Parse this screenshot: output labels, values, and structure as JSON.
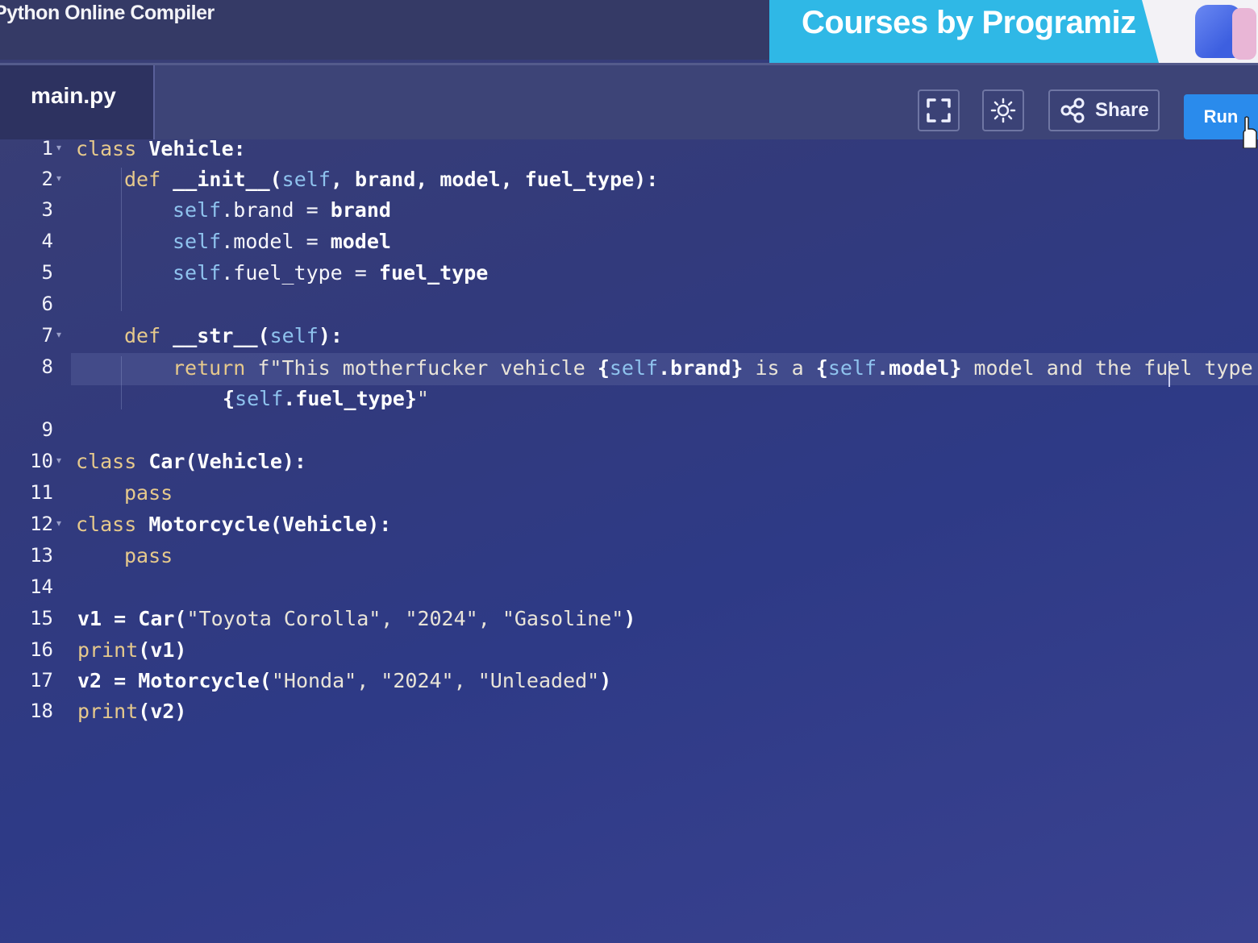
{
  "app": {
    "title": "Python Online Compiler"
  },
  "banner": {
    "text": "Courses by Programiz"
  },
  "editor": {
    "file_name": "main.py",
    "toolbar": {
      "fullscreen_icon": "fullscreen-icon",
      "theme_icon": "sun-icon",
      "share_icon": "share-icon",
      "share_label": "Share",
      "run_label": "Run"
    },
    "line_numbers": [
      "1",
      "2",
      "3",
      "4",
      "5",
      "6",
      "7",
      "8",
      "9",
      "10",
      "11",
      "12",
      "13",
      "14",
      "15",
      "16",
      "17",
      "18"
    ],
    "code": {
      "l1": {
        "kw": "class",
        "rest": " Vehicle:"
      },
      "l2": {
        "kw": "def",
        "name": " __init__(",
        "self": "self",
        "rest": ", brand, model, fuel_type):"
      },
      "l3": {
        "self": "self",
        "attr": ".brand = ",
        "rest": "brand"
      },
      "l4": {
        "self": "self",
        "attr": ".model = ",
        "rest": "model"
      },
      "l5": {
        "self": "self",
        "attr": ".fuel_type = ",
        "rest": "fuel_type"
      },
      "l7": {
        "kw": "def",
        "name": " __str__(",
        "self": "self",
        "rest": "):"
      },
      "l8a": {
        "kw": "return",
        "str1": " f\"This motherfucker vehicle ",
        "e1a": "{",
        "e1s": "self",
        "e1b": ".brand}",
        "str2": " is a ",
        "e2a": "{",
        "e2s": "self",
        "e2b": ".model}",
        "str3": " model and the fuel type is"
      },
      "l8b": {
        "e3a": "{",
        "e3s": "self",
        "e3b": ".fuel_type}",
        "str4": "\""
      },
      "l10": {
        "kw": "class",
        "rest": " Car(Vehicle):"
      },
      "l11": {
        "kw": "pass"
      },
      "l12": {
        "kw": "class",
        "rest": " Motorcycle(Vehicle):"
      },
      "l13": {
        "kw": "pass"
      },
      "l15": {
        "a": "v1 = ",
        "b": "Car(",
        "s": "\"Toyota Corolla\", \"2024\", \"Gasoline\"",
        "c": ")"
      },
      "l16": {
        "fn": "print",
        "rest": "(v1)"
      },
      "l17": {
        "a": "v2 = ",
        "b": "Motorcycle(",
        "s": "\"Honda\", \"2024\", \"Unleaded\"",
        "c": ")"
      },
      "l18": {
        "fn": "print",
        "rest": "(v2)"
      }
    },
    "active_line": "8"
  },
  "colors": {
    "background": "#323a7c",
    "keyword": "#e6c98c",
    "self": "#8fc3ee",
    "run_button": "#2a8bec",
    "banner": "#2fb8e6"
  }
}
